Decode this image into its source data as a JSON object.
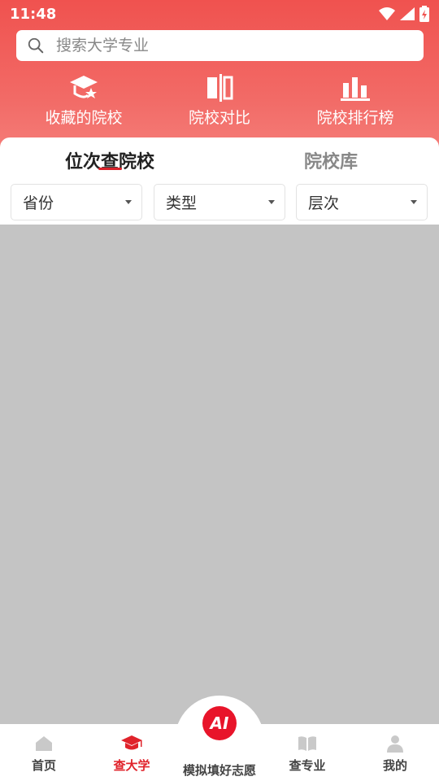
{
  "status_bar": {
    "time": "11:48"
  },
  "search": {
    "placeholder": "搜索大学专业"
  },
  "quick_actions": [
    {
      "label": "收藏的院校",
      "icon": "graduation-star-icon"
    },
    {
      "label": "院校对比",
      "icon": "compare-icon"
    },
    {
      "label": "院校排行榜",
      "icon": "ranking-bars-icon"
    }
  ],
  "tabs": {
    "active": "位次查院校",
    "inactive": "院校库"
  },
  "filters": [
    {
      "label": "省份"
    },
    {
      "label": "类型"
    },
    {
      "label": "层次"
    }
  ],
  "bottom_nav": {
    "items": [
      {
        "label": "首页",
        "icon": "home-icon"
      },
      {
        "label": "查大学",
        "icon": "graduation-cap-icon"
      },
      {
        "label": "查专业",
        "icon": "book-icon"
      },
      {
        "label": "我的",
        "icon": "user-icon"
      }
    ],
    "ai": {
      "badge": "AI",
      "label": "模拟填好志愿"
    }
  },
  "colors": {
    "brand_red": "#e8142a",
    "header_red": "#f0524f",
    "content_gray": "#c4c4c4"
  }
}
